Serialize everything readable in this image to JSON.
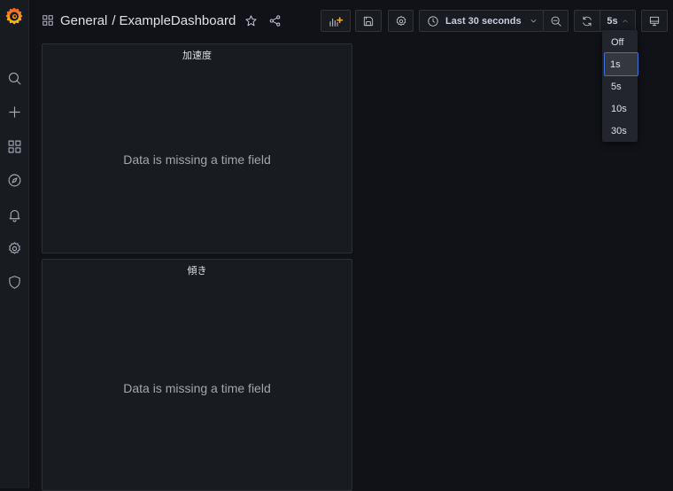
{
  "breadcrumb": {
    "folder": "General",
    "separator": "/",
    "dashboard": "ExampleDashboard"
  },
  "toolbar": {
    "time_range": "Last 30 seconds",
    "refresh_interval": "5s"
  },
  "refresh_menu": {
    "options": [
      "Off",
      "1s",
      "5s",
      "10s",
      "30s"
    ],
    "highlighted": "1s"
  },
  "panels": [
    {
      "title": "加速度",
      "message": "Data is missing a time field"
    },
    {
      "title": "傾き",
      "message": "Data is missing a time field"
    }
  ],
  "colors": {
    "background": "#111217",
    "panel": "#181b1f",
    "accent": "#3d71d9",
    "grafana_orange": "#f05a28"
  },
  "icons": {
    "sidemenu": [
      "grafana-logo-icon",
      "search-icon",
      "plus-icon",
      "dashboards-icon",
      "explore-compass-icon",
      "bell-icon",
      "gear-icon",
      "shield-icon"
    ],
    "navbar": [
      "dashboard-grid-icon",
      "star-icon",
      "share-icon",
      "add-panel-icon",
      "save-icon",
      "settings-gear-icon",
      "clock-icon",
      "chevron-down-icon",
      "zoom-out-icon",
      "refresh-icon",
      "chevron-up-icon",
      "tv-mode-icon"
    ]
  }
}
